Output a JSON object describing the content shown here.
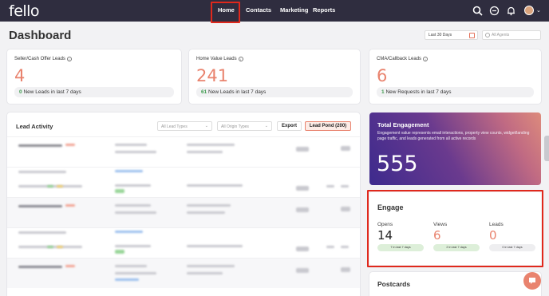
{
  "nav": {
    "logo": "fello",
    "items": [
      "Home",
      "Contacts",
      "Marketing",
      "Reports"
    ],
    "active": "Home"
  },
  "header": {
    "title": "Dashboard",
    "date_range": "Last 30 Days",
    "agents_placeholder": "All Agents"
  },
  "stats": [
    {
      "label": "Seller/Cash Offer Leads",
      "value": "4",
      "sub_count": "0",
      "sub_text": "New Leads in last 7 days"
    },
    {
      "label": "Home Value Leads",
      "value": "241",
      "sub_count": "61",
      "sub_text": "New Leads in last 7 days"
    },
    {
      "label": "CMA/Callback Leads",
      "value": "6",
      "sub_count": "1",
      "sub_text": "New Requests in last 7 days"
    }
  ],
  "lead_activity": {
    "title": "Lead Activity",
    "filter_types": "All Lead Types",
    "filter_origins": "All Origin Types",
    "export_label": "Export",
    "pond_label": "Lead Pond (200)"
  },
  "total_engagement": {
    "title": "Total Engagement",
    "description": "Engagement value represents email interactions, property view counts, widget/landing page traffic, and leads generated from all active records",
    "value": "555"
  },
  "engage": {
    "title": "Engage",
    "metrics": [
      {
        "label": "Opens",
        "value": "14",
        "pill": "7 in last 7 days"
      },
      {
        "label": "Views",
        "value": "6",
        "pill": "2 in last 7 days"
      },
      {
        "label": "Leads",
        "value": "0",
        "pill": "0 in last 7 days"
      }
    ]
  },
  "postcards": {
    "title": "Postcards"
  },
  "colors": {
    "nav_bg": "#2f2d3f",
    "accent": "#e9836e",
    "green": "#3f9b4f",
    "highlight": "#e0281c"
  }
}
